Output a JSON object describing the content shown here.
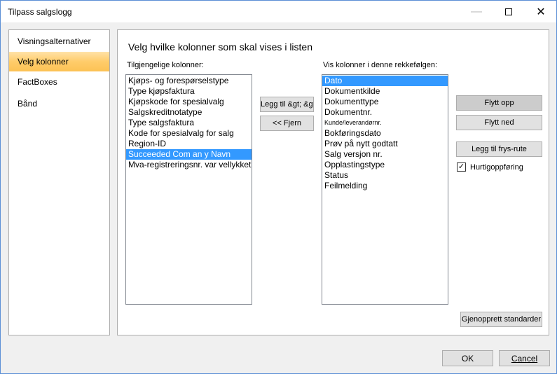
{
  "window": {
    "title": "Tilpass salgslogg"
  },
  "nav": {
    "items": [
      {
        "label": "Visningsalternativer",
        "selected": false
      },
      {
        "label": "Velg kolonner",
        "selected": true
      },
      {
        "label": "FactBoxes",
        "selected": false
      },
      {
        "label": "Bånd",
        "selected": false
      }
    ]
  },
  "main": {
    "heading": "Velg hvilke kolonner som skal vises i listen",
    "available_label": "Tilgjengelige kolonner:",
    "available": [
      "Kjøps- og forespørselstype",
      "Type kjøpsfaktura",
      "Kjøpskode for spesialvalg",
      "Salgskreditnotatype",
      "Type salgsfaktura",
      "Kode for spesialvalg for salg",
      "Region-ID",
      "Succeeded Com an y Navn",
      "Mva-registreringsnr. var vellykket"
    ],
    "available_selected": "Succeeded Com an y Navn",
    "shown_label": "Vis kolonner i denne rekkefølgen:",
    "shown": [
      "Dato",
      "Dokumentkilde",
      "Dokumenttype",
      "Dokumentnr.",
      "Kunde/leverandørnr.",
      "Bokføringsdato",
      "Prøv på nytt godtatt",
      "Salg versjon nr.",
      "Opplastingstype",
      "Status",
      "Feilmelding"
    ],
    "shown_selected": "Dato",
    "add_button": "Legg til &gt; &gt;",
    "remove_button": "<< Fjern",
    "move_up_button": "Flytt opp",
    "move_down_button": "Flytt ned",
    "freeze_button": "Legg til frys-rute",
    "quick_entry_label": "Hurtigoppføring",
    "quick_entry_checked": true,
    "restore_button": "Gjenopprett standarder"
  },
  "footer": {
    "ok_label": "OK",
    "cancel_label": "Cancel"
  },
  "icons": {
    "minimize": "minimize-icon",
    "maximize": "maximize-icon",
    "close": "close-icon",
    "check": "checkmark-icon"
  },
  "colors": {
    "selection": "#3399ff",
    "nav_selected": "#ffcc6a",
    "window_border": "#5b8fd6"
  }
}
